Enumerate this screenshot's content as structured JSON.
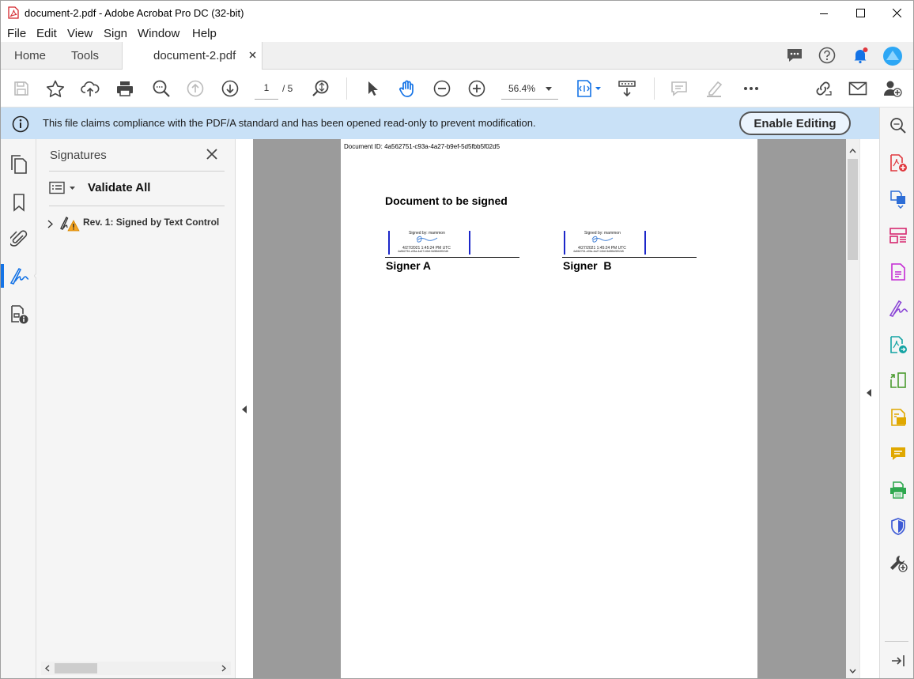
{
  "window": {
    "title": "document-2.pdf - Adobe Acrobat Pro DC (32-bit)"
  },
  "menu": [
    "File",
    "Edit",
    "View",
    "Sign",
    "Window",
    "Help"
  ],
  "tabs": {
    "home": "Home",
    "tools": "Tools",
    "document": "document-2.pdf"
  },
  "toolbar": {
    "page_current": "1",
    "page_total": "/ 5",
    "zoom": "56.4%"
  },
  "banner": {
    "message": "This file claims compliance with the PDF/A standard and has been opened read-only to prevent modification.",
    "button": "Enable Editing"
  },
  "signatures_panel": {
    "title": "Signatures",
    "validate_all": "Validate All",
    "items": [
      {
        "label": "Rev. 1: Signed by Text Control"
      }
    ]
  },
  "document": {
    "doc_id": "Document ID: 4a562751-c93a-4a27-b9ef-5d5fbb5f02d5",
    "heading": "Document to be signed",
    "signers": [
      {
        "label": "Signer A",
        "signed_by": "Signed by: mammon",
        "date": "4/27/2021 1:45:24 PM UTC",
        "hash": "4a562751-c93a-4a27-b9ef-5d5fbb5f02d5"
      },
      {
        "label": "Signer  B",
        "signed_by": "Signed by: mammon",
        "date": "4/27/2021 1:45:24 PM UTC",
        "hash": "4a562751-c93a-4a27-b9ef-5d5fbb5f02d5"
      }
    ]
  },
  "colors": {
    "accent": "#1473e6",
    "banner": "#c9e1f7",
    "page_gray": "#9b9b9b",
    "signature_bar": "#1c27c9"
  }
}
